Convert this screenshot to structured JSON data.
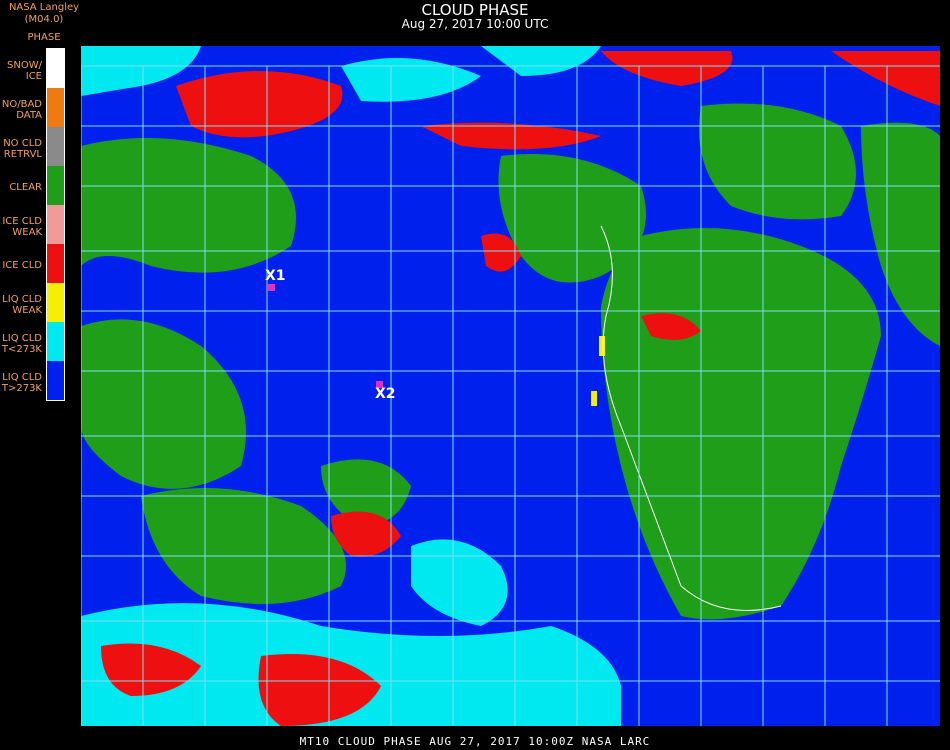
{
  "brand": "NASA Langley (M04.0)",
  "legend_title": "PHASE",
  "title": "CLOUD PHASE",
  "subtitle": "Aug 27, 2017 10:00 UTC",
  "legend": [
    {
      "label1": "SNOW/",
      "label2": "ICE",
      "color": "#ffffff"
    },
    {
      "label1": "NO/BAD",
      "label2": "DATA",
      "color": "#f07a10"
    },
    {
      "label1": "NO CLD",
      "label2": "RETRVL",
      "color": "#8a8a8a"
    },
    {
      "label1": "CLEAR",
      "label2": "",
      "color": "#1f9e1a"
    },
    {
      "label1": "ICE CLD",
      "label2": "WEAK",
      "color": "#f09a9a"
    },
    {
      "label1": "ICE CLD",
      "label2": "",
      "color": "#ee1010"
    },
    {
      "label1": "LIQ CLD",
      "label2": "WEAK",
      "color": "#f5f000"
    },
    {
      "label1": "LIQ CLD",
      "label2": "T<273K",
      "color": "#00e8f0"
    },
    {
      "label1": "LIQ CLD",
      "label2": "T>273K",
      "color": "#0020ee"
    }
  ],
  "markers": [
    {
      "label": "X1"
    },
    {
      "label": "X2"
    }
  ],
  "footer": "MT10  CLOUD PHASE   AUG 27, 2017 10:00Z   NASA LARC"
}
